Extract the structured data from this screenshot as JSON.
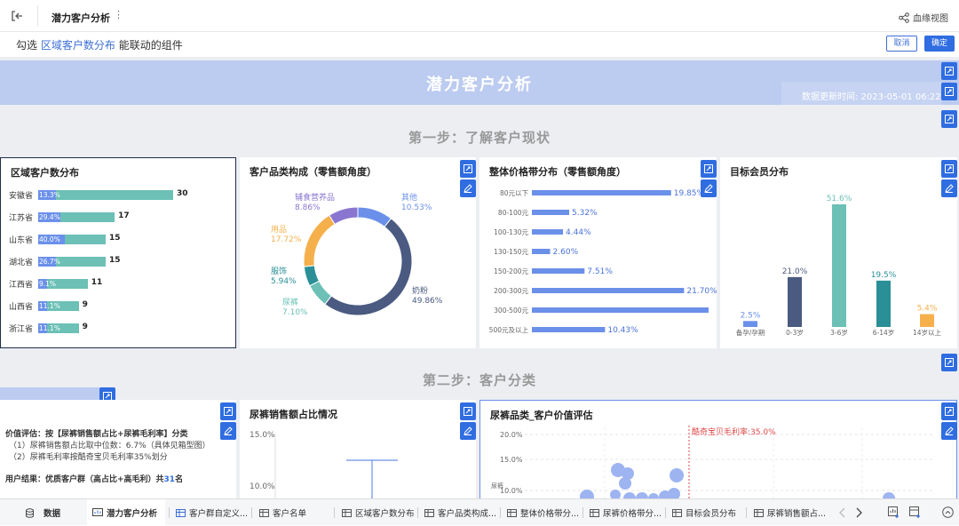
{
  "topbar": {
    "title": "潜力客户分析",
    "more": "⋮",
    "lineage": "血缘视图"
  },
  "selection": {
    "prefix": "勾选",
    "highlight": "区域客户数分布",
    "suffix": "能联动的组件",
    "cancel": "取消",
    "confirm": "确定"
  },
  "banner": {
    "title": "潜力客户分析",
    "update": "数据更新时间: 2023-05-01 06:22"
  },
  "steps": {
    "step1": "第一步：了解客户现状",
    "step2": "第二步：客户分类"
  },
  "region": {
    "title": "区域客户数分布",
    "rows": [
      {
        "name": "安徽省",
        "pct": "13.3%",
        "value": 30
      },
      {
        "name": "江苏省",
        "pct": "29.4%",
        "value": 17
      },
      {
        "name": "山东省",
        "pct": "40.0%",
        "value": 15
      },
      {
        "name": "湖北省",
        "pct": "26.7%",
        "value": 15
      },
      {
        "name": "江西省",
        "pct": "9.1%",
        "value": 11
      },
      {
        "name": "山西省",
        "pct": "11.1%",
        "value": 9
      },
      {
        "name": "浙江省",
        "pct": "11.1%",
        "value": 9
      }
    ]
  },
  "category": {
    "title": "客户品类构成（零售额角度）",
    "slices": [
      {
        "name": "其他",
        "pct": "10.53%",
        "value": 10.53,
        "color": "#6b90ea"
      },
      {
        "name": "奶粉",
        "pct": "49.86%",
        "value": 49.86,
        "color": "#4a5a80"
      },
      {
        "name": "尿裤",
        "pct": "7.10%",
        "value": 7.1,
        "color": "#6cc0b6"
      },
      {
        "name": "服饰",
        "pct": "5.94%",
        "value": 5.94,
        "color": "#2a8f96"
      },
      {
        "name": "用品",
        "pct": "17.72%",
        "value": 17.72,
        "color": "#f5b04c"
      },
      {
        "name": "辅食营养品",
        "pct": "8.86%",
        "value": 8.86,
        "color": "#8a76d0"
      }
    ]
  },
  "price": {
    "title": "整体价格带分布（零售额角度）",
    "rows": [
      {
        "name": "80元以下",
        "pct": "19.85%",
        "value": 19.85
      },
      {
        "name": "80-100元",
        "pct": "5.32%",
        "value": 5.32
      },
      {
        "name": "100-130元",
        "pct": "4.44%",
        "value": 4.44
      },
      {
        "name": "130-150元",
        "pct": "2.60%",
        "value": 2.6
      },
      {
        "name": "150-200元",
        "pct": "7.51%",
        "value": 7.51
      },
      {
        "name": "200-300元",
        "pct": "21.70%",
        "value": 21.7
      },
      {
        "name": "300-500元",
        "pct": "",
        "value": 25.2
      },
      {
        "name": "500元及以上",
        "pct": "10.43%",
        "value": 10.43
      }
    ]
  },
  "member": {
    "title": "目标会员分布",
    "bars": [
      {
        "name": "备孕/孕期",
        "pct": "2.5%",
        "value": 2.5,
        "color": "#6b90ea",
        "lcolor": "#6b90ea"
      },
      {
        "name": "0-3岁",
        "pct": "21.0%",
        "value": 21.0,
        "color": "#4a5a80",
        "lcolor": "#4a5a80"
      },
      {
        "name": "3-6岁",
        "pct": "51.6%",
        "value": 51.6,
        "color": "#6cc0b6",
        "lcolor": "#6cc0b6"
      },
      {
        "name": "6-14岁",
        "pct": "19.5%",
        "value": 19.5,
        "color": "#2a8f96",
        "lcolor": "#2a8f96"
      },
      {
        "name": "14岁以上",
        "pct": "5.4%",
        "value": 5.4,
        "color": "#f5b04c",
        "lcolor": "#f5b04c"
      }
    ]
  },
  "valuecard": {
    "t1": "价值评估：按【尿裤销售额占比+尿裤毛利率】分类",
    "t2": "（1）尿裤销售额占比取中位数：6.7%（具体见箱型图）",
    "t3": "（2）尿裤毛利率按酷奇宝贝毛利率35%划分",
    "t4": "用户结果：优质客户群（高占比+高毛利）共",
    "t4num": "31",
    "t4end": "名"
  },
  "boxcard": {
    "title": "尿裤销售额占比情况",
    "y1": "15.0%",
    "y2": "10.0%"
  },
  "scatter": {
    "title": "尿裤品类_客户价值评估",
    "y1": "20.0%",
    "y2": "15.0%",
    "y3": "10.0%",
    "refline": "酷奇宝贝毛利率:35.0%",
    "yaxis": "尿裤"
  },
  "tabs": [
    "数据",
    "潜力客户分析",
    "客户群自定义...",
    "客户名单",
    "区域客户数分布",
    "客户品类构成...",
    "整体价格带分...",
    "尿裤价格带分...",
    "目标会员分布",
    "尿裤销售额占..."
  ]
}
